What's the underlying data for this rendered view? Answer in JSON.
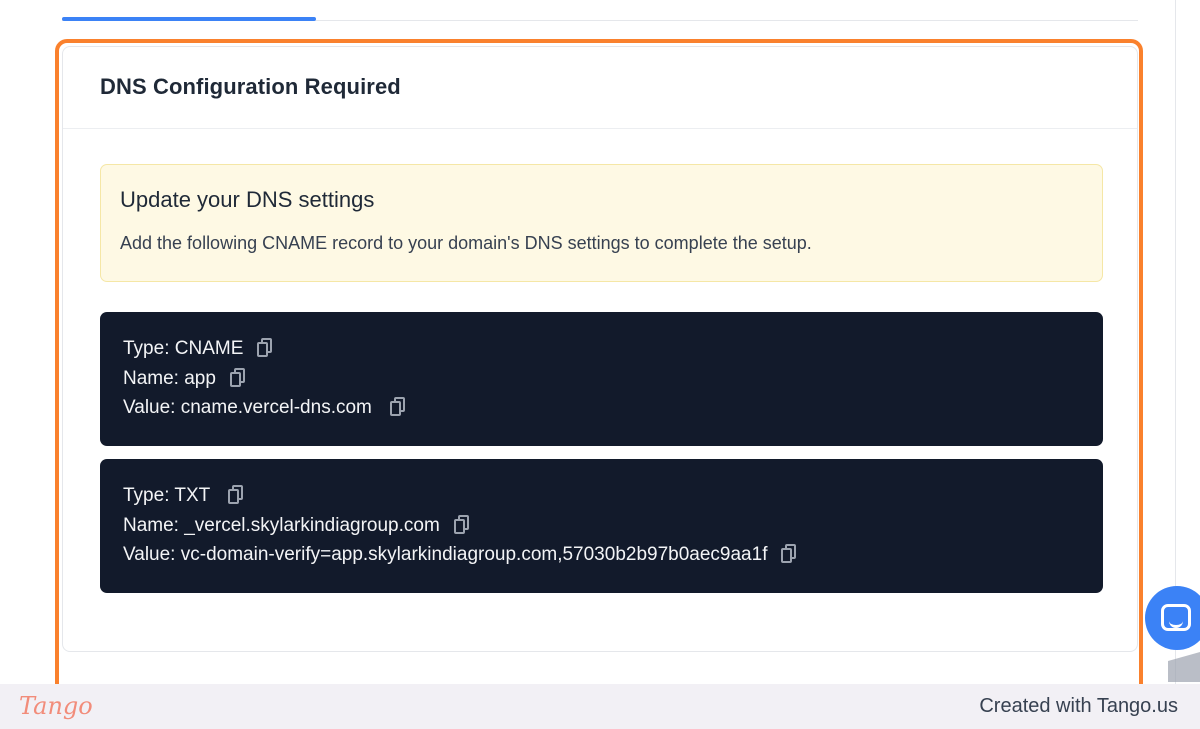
{
  "card": {
    "title": "DNS Configuration Required"
  },
  "alert": {
    "title": "Update your DNS settings",
    "text": "Add the following CNAME record to your domain's DNS settings to complete the setup."
  },
  "records": [
    {
      "type": "Type: CNAME",
      "name": "Name: app",
      "value": "Value: cname.vercel-dns.com"
    },
    {
      "type": "Type: TXT",
      "name": "Name: _vercel.skylarkindiagroup.com",
      "value": "Value: vc-domain-verify=app.skylarkindiagroup.com,57030b2b97b0aec9aa1f"
    }
  ],
  "icons": {
    "copy": "copy-icon",
    "chat": "chat-icon"
  },
  "footer": {
    "logo": "Tango",
    "created_with": "Created with Tango.us"
  },
  "colors": {
    "accent": "#3b82f6",
    "highlight": "#f97316",
    "record_bg": "#121a2b",
    "alert_bg": "#fef9e4"
  }
}
